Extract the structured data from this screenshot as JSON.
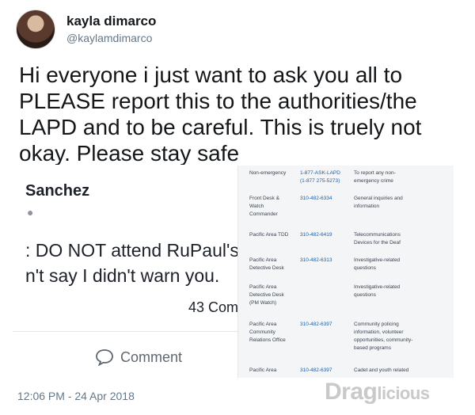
{
  "tweet": {
    "display_name": "kayla dimarco",
    "handle": "@kaylamdimarco",
    "text_lines": [
      "Hi everyone i just want to ask you all to",
      "PLEASE report this to the authorities/the",
      "LAPD and to be careful. This is truely not",
      "okay. Please stay safe"
    ],
    "timestamp": "12:06 PM - 24 Apr 2018"
  },
  "fb_post": {
    "name": "Sanchez",
    "lines": [
      ": DO NOT attend RuPaul's D",
      "n't say I didn't warn you."
    ],
    "comment_count": "43 Com",
    "comment_label": "Comment"
  },
  "lapd_table": [
    {
      "c1": [
        "Non-emergency"
      ],
      "c2": [
        "1-877-ASK-LAPD",
        "(1-877 275-5273)"
      ],
      "c3": [
        "To report any non-",
        "emergency crime"
      ]
    },
    {
      "c1": [
        "Front Desk &",
        "Watch",
        "Commander"
      ],
      "c2": [
        "310-482-6334"
      ],
      "c3": [
        "General inquiries and",
        "information"
      ]
    },
    {
      "c1": [
        "Pacific Area TDD"
      ],
      "c2": [
        "310-482-6419"
      ],
      "c3": [
        "Telecommunications",
        "Devices for the Deaf"
      ]
    },
    {
      "c1": [
        "Pacific Area",
        "Detective Desk"
      ],
      "c2": [
        "310-482-6313"
      ],
      "c3": [
        "Investigative-related",
        "questions"
      ]
    },
    {
      "c1": [
        "Pacific Area",
        "Detective Desk",
        "(PM Watch)"
      ],
      "c2": [],
      "c3": [
        "Investigative-related",
        "questions"
      ]
    },
    {
      "c1": [
        "Pacific Area",
        "Community",
        "Relations Office"
      ],
      "c2": [
        "310-482-6397"
      ],
      "c3": [
        "Community policing",
        "information, volunteer",
        "opportunities, community-",
        "based programs"
      ]
    },
    {
      "c1": [
        "Pacific Area"
      ],
      "c2": [
        "310-482-6397"
      ],
      "c3": [
        "Cadet and youth related"
      ]
    }
  ],
  "watermark": {
    "main": "Drag",
    "small": "licious"
  }
}
